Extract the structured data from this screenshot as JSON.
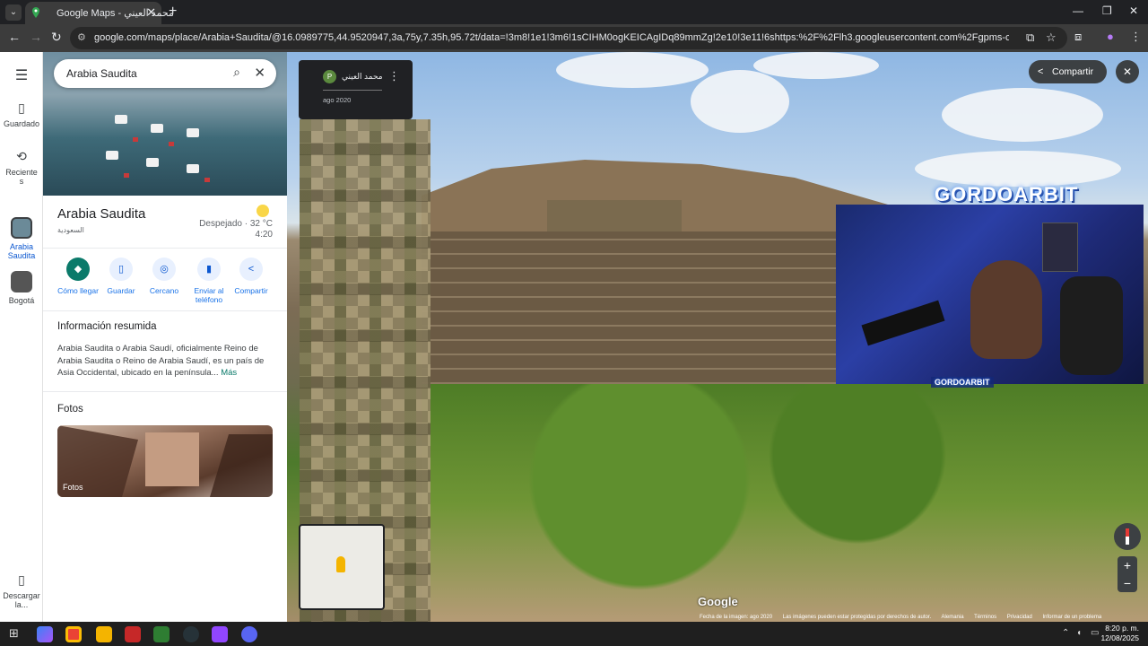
{
  "browser": {
    "tab_title": "Google Maps - محمد العيني",
    "url": "google.com/maps/place/Arabia+Saudita/@16.0989775,44.9520947,3a,75y,7.35h,95.72t/data=!3m8!1e1!3m6!1sCIHM0ogKEICAgIDq89mmZg!2e10!3e11!6shttps:%2F%2Flh3.googleusercontent.com%2Fgpms-cs-s%2FAB8u6HaNKT355FGjtthMzT7f6-9t9..."
  },
  "rail": {
    "saved_label": "Guardado",
    "recents_label": "Recientes",
    "place1_label": "Arabia Saudita",
    "place2_label": "Bogotá",
    "download_label": "Descargar la..."
  },
  "panel": {
    "search_value": "Arabia Saudita",
    "title": "Arabia Saudita",
    "subtitle": "السعودية",
    "weather_line1": "Despejado · 32 °C",
    "weather_line2": "4:20",
    "actions": [
      {
        "label": "Cómo llegar",
        "icon": "◆"
      },
      {
        "label": "Guardar",
        "icon": "▯"
      },
      {
        "label": "Cercano",
        "icon": "◎"
      },
      {
        "label": "Enviar al teléfono",
        "icon": "▮"
      },
      {
        "label": "Compartir",
        "icon": "<"
      }
    ],
    "summary_title": "Información resumida",
    "summary_text": "Arabia Saudita o Arabia Saudí,  oficialmente Reino de Arabia Saudita o Reino de Arabia Saudí, es un país de Asia Occidental, ubicado en la península... ",
    "summary_more": "Más",
    "photos_title": "Fotos",
    "photo_label": "Fotos"
  },
  "streetview": {
    "author_name": "محمد العيني",
    "author_initial": "P",
    "author_date": "ago 2020",
    "share_label": "Compartir",
    "google_logo": "Google",
    "footer": [
      "Fecha de la imagen: ago 2020",
      "Las imágenes pueden estar protegidas por derechos de autor.",
      "Alemania",
      "Términos",
      "Privacidad",
      "Informar de un problema"
    ]
  },
  "overlay": {
    "title": "GORDOARBIT",
    "tag": "GORDOARBIT"
  },
  "taskbar": {
    "time": "8:20 p. m.",
    "date": "12/08/2025"
  },
  "colors": {
    "accent": "#0b7a6a",
    "link": "#1a73e8"
  }
}
